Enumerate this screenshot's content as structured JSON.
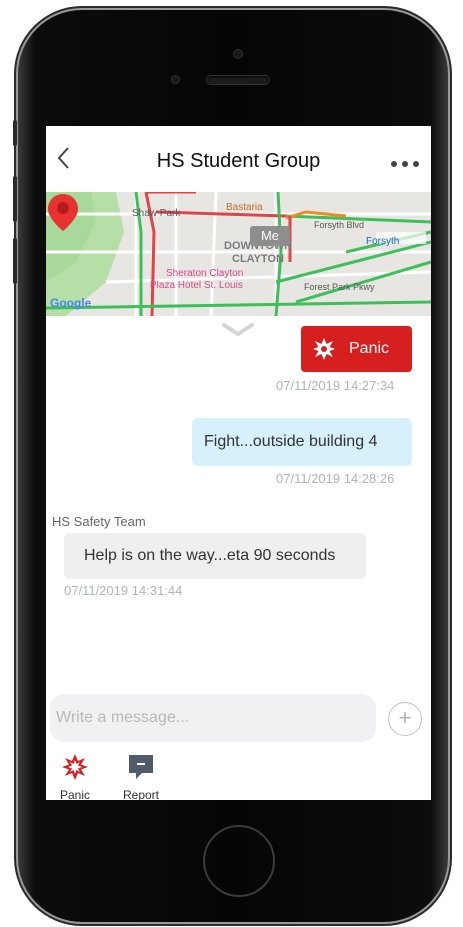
{
  "header": {
    "title": "HS Student Group"
  },
  "map": {
    "labels": {
      "shaw_park": "Shaw Park",
      "bastaria": "Bastaria",
      "forsyth_blvd": "Forsyth Blvd",
      "forsyth": "Forsyth",
      "downtown": "DOWNTOWN",
      "clayton": "CLAYTON",
      "sheraton": "Sheraton Clayton",
      "plaza_hotel": "Plaza Hotel St. Louis",
      "forest_park": "Forest Park Pkwy",
      "me": "Me",
      "google": "Google"
    }
  },
  "messages": {
    "panic": {
      "label": "Panic",
      "timestamp": "07/11/2019 14:27:34"
    },
    "sent": {
      "text": "Fight...outside building 4",
      "timestamp": "07/11/2019 14:28:26"
    },
    "received": {
      "sender": "HS Safety Team",
      "text": "Help is on the way...eta 90 seconds",
      "timestamp": "07/11/2019 14:31:44"
    }
  },
  "composer": {
    "placeholder": "Write a message...",
    "value": ""
  },
  "actions": [
    {
      "label": "Panic",
      "icon": "panic-burst-icon"
    },
    {
      "label": "Report",
      "icon": "report-comment-icon"
    }
  ],
  "colors": {
    "panic_red": "#d6201f",
    "sent_bubble": "#d6f1fb",
    "received_bubble": "#efefef",
    "timestamp": "#b0b4bb"
  }
}
